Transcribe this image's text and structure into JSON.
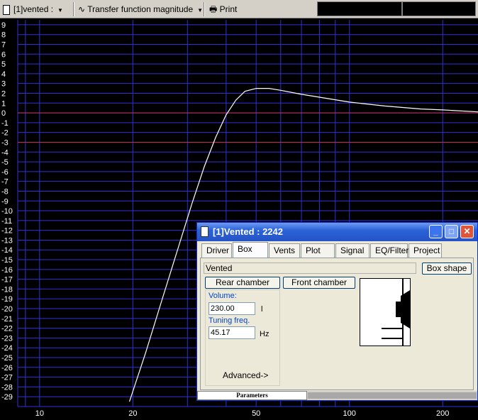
{
  "toolbar": {
    "project_select": "[1]vented :",
    "view_select": "Transfer function magnitude",
    "print_label": "Print"
  },
  "chart_data": {
    "type": "line",
    "title": "",
    "xlabel": "",
    "ylabel": "",
    "x_scale": "log",
    "xlim": [
      8.5,
      260
    ],
    "ylim": [
      -30,
      9.5
    ],
    "x_tick_labels": [
      "10",
      "20",
      "50",
      "100",
      "200"
    ],
    "y_tick_labels": [
      "9",
      "8",
      "7",
      "6",
      "5",
      "4",
      "3",
      "2",
      "1",
      "0",
      "-1",
      "-2",
      "-3",
      "-4",
      "-5",
      "-6",
      "-7",
      "-8",
      "-9",
      "-10",
      "-11",
      "-12",
      "-13",
      "-14",
      "-15",
      "-16",
      "-17",
      "-18",
      "-19",
      "-20",
      "-21",
      "-22",
      "-23",
      "-24",
      "-25",
      "-26",
      "-27",
      "-28",
      "-29"
    ],
    "reference_lines_db": [
      0,
      -3
    ],
    "grid": true,
    "colors": {
      "background": "#000000",
      "grid": "#3030d8",
      "reference": "#c83050",
      "curve": "#ffffff"
    },
    "series": [
      {
        "x": [
          19.5,
          22,
          25,
          28,
          31,
          34,
          37,
          40,
          43,
          46,
          50,
          55,
          60,
          70,
          80,
          100,
          130,
          170,
          200,
          260
        ],
        "y": [
          -29.5,
          -24.5,
          -18.8,
          -13.8,
          -9.3,
          -5.5,
          -2.5,
          -0.2,
          1.3,
          2.2,
          2.5,
          2.5,
          2.3,
          1.9,
          1.6,
          1.1,
          0.7,
          0.4,
          0.3,
          0.1
        ]
      }
    ]
  },
  "dialog": {
    "title": "[1]Vented : 2242",
    "tabs": [
      "Driver",
      "Box",
      "Vents",
      "Plot",
      "Signal",
      "EQ/Filter",
      "Project"
    ],
    "active_tab": "Box",
    "box_shape_value": "Vented",
    "box_shape_button": "Box shape",
    "rear_chamber_button": "Rear chamber",
    "front_chamber_button": "Front chamber",
    "volume_label": "Volume:",
    "volume_value": "230.00",
    "volume_unit": "l",
    "tuning_label": "Tuning freq.",
    "tuning_value": "45.17",
    "tuning_unit": "Hz",
    "advanced_label": "Advanced->",
    "status_label": "Parameters"
  }
}
